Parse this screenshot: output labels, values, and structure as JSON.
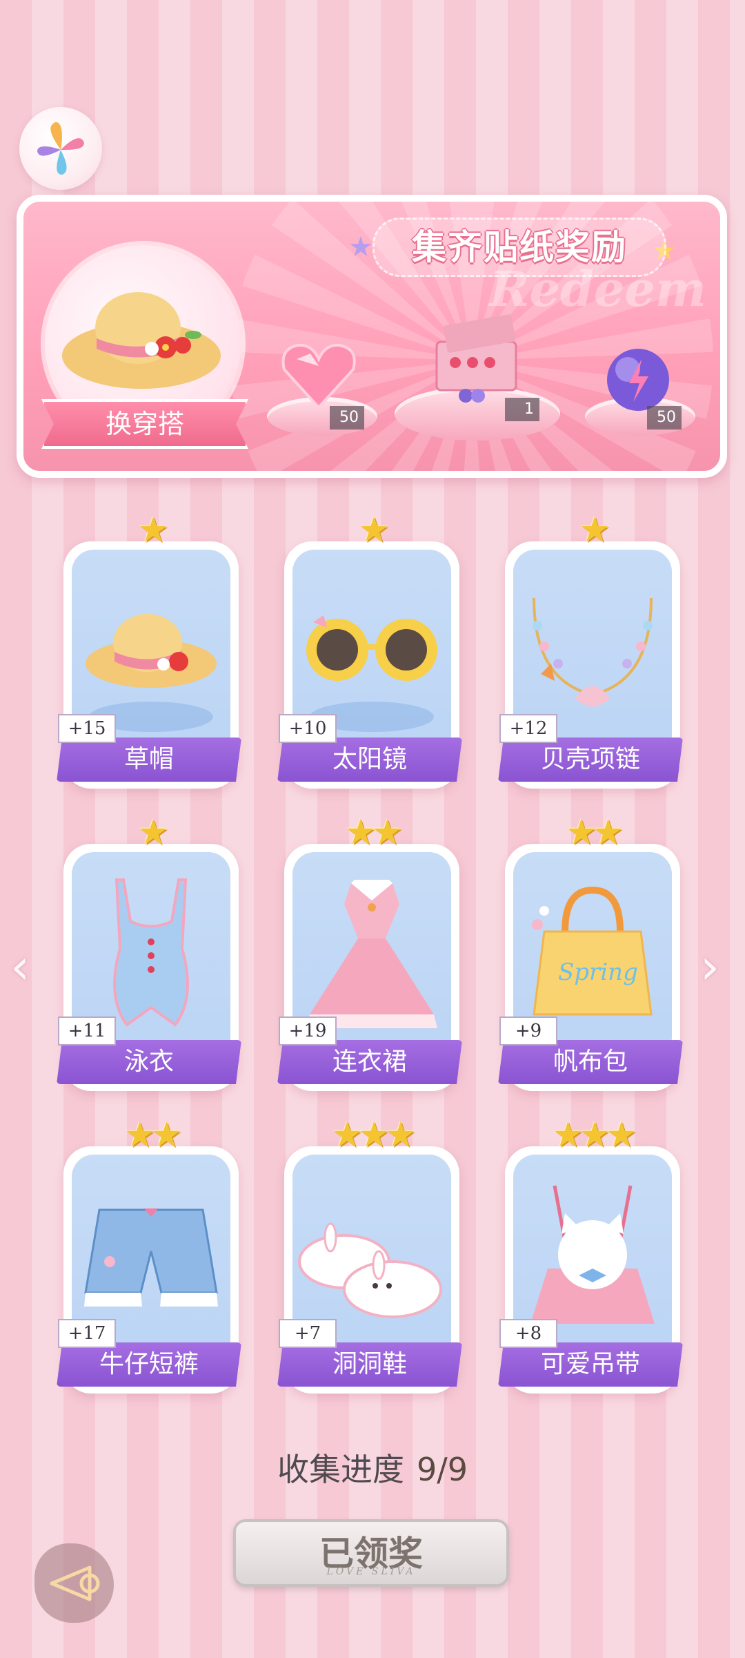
{
  "banner": {
    "title": "集齐贴纸奖励",
    "watermark": "Redeem",
    "switch_label": "换穿搭",
    "rewards": [
      {
        "name": "pink-heart-gem",
        "count": "50"
      },
      {
        "name": "gift-box",
        "count": "1"
      },
      {
        "name": "energy-orb",
        "count": "50"
      }
    ]
  },
  "items": [
    {
      "label": "草帽",
      "bonus": "+15",
      "stars": "★"
    },
    {
      "label": "太阳镜",
      "bonus": "+10",
      "stars": "★"
    },
    {
      "label": "贝壳项链",
      "bonus": "+12",
      "stars": "★"
    },
    {
      "label": "泳衣",
      "bonus": "+11",
      "stars": "★"
    },
    {
      "label": "连衣裙",
      "bonus": "+19",
      "stars": "★★"
    },
    {
      "label": "帆布包",
      "bonus": "+9",
      "stars": "★★"
    },
    {
      "label": "牛仔短裤",
      "bonus": "+17",
      "stars": "★★"
    },
    {
      "label": "洞洞鞋",
      "bonus": "+7",
      "stars": "★★★"
    },
    {
      "label": "可爱吊带",
      "bonus": "+8",
      "stars": "★★★"
    }
  ],
  "progress": {
    "label": "收集进度",
    "value": "9/9"
  },
  "claim": {
    "label": "已领奖",
    "sub": "LOVE SLIVA"
  },
  "colors": {
    "accent": "#8a54d2",
    "banner": "#ff9fb8",
    "star": "#f5c531"
  }
}
